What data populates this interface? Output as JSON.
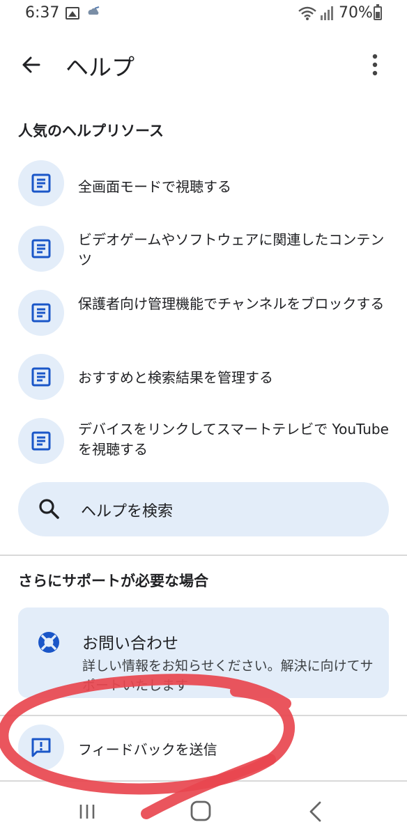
{
  "status_bar": {
    "time": "6:37",
    "battery": "70%"
  },
  "app_bar": {
    "title": "ヘルプ"
  },
  "popular_resources": {
    "heading": "人気のヘルプリソース",
    "items": [
      {
        "label": "全画面モードで視聴する"
      },
      {
        "label": "ビデオゲームやソフトウェアに関連したコンテンツ"
      },
      {
        "label": "保護者向け管理機能でチャンネルをブロックする"
      },
      {
        "label": "おすすめと検索結果を管理する"
      },
      {
        "label": "デバイスをリンクしてスマートテレビで YouTube を視聴する"
      }
    ]
  },
  "search": {
    "label": "ヘルプを検索"
  },
  "support": {
    "heading": "さらにサポートが必要な場合",
    "contact_title": "お問い合わせ",
    "contact_description": "詳しい情報をお知らせください。解決に向けてサポートいたします"
  },
  "feedback": {
    "label": "フィードバックを送信"
  },
  "colors": {
    "accent": "#1a56c8",
    "chip_background": "#e3edf9",
    "annotation_stroke": "#e8474f"
  }
}
